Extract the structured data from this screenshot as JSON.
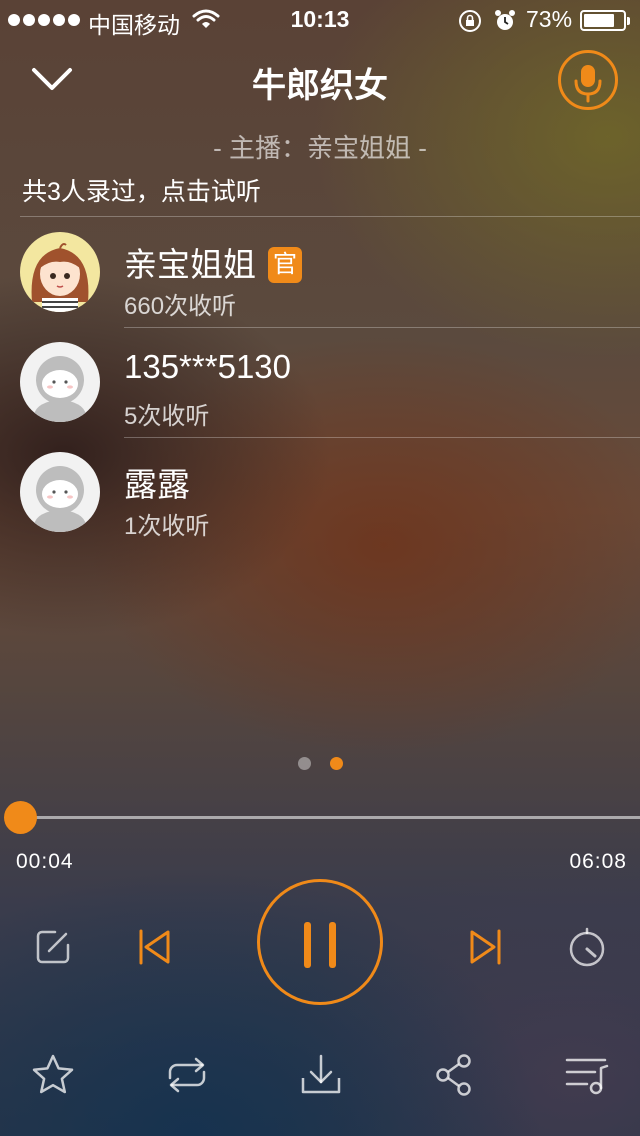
{
  "status_bar": {
    "carrier": "中国移动",
    "time": "10:13",
    "battery": "73%",
    "battery_level": 0.73
  },
  "header": {
    "title": "牛郎织女",
    "anchor": "- 主播：亲宝姐姐 -"
  },
  "summary": "共3人录过，点击试听",
  "recorders": [
    {
      "name": "亲宝姐姐",
      "badge": "官",
      "count": "660次收听"
    },
    {
      "name": "135***5130",
      "count": "5次收听"
    },
    {
      "name": "露露",
      "count": "1次收听"
    }
  ],
  "pager": {
    "pages": 2,
    "current": 2
  },
  "player": {
    "current_time": "00:04",
    "total_time": "06:08",
    "progress": 0.011
  },
  "colors": {
    "accent": "#f08a19"
  },
  "icons": {
    "top": [
      "chevron-down-icon",
      "microphone-icon"
    ],
    "controls": [
      "edit-icon",
      "previous-track-icon",
      "pause-icon",
      "next-track-icon",
      "timer-icon"
    ],
    "bottom": [
      "star-icon",
      "repeat-icon",
      "download-icon",
      "share-icon",
      "playlist-icon"
    ]
  }
}
